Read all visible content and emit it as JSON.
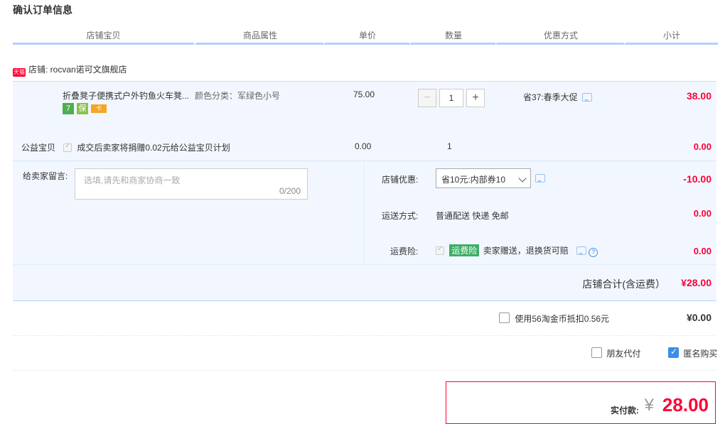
{
  "page_title": "确认订单信息",
  "columns": [
    "店铺宝贝",
    "商品属性",
    "单价",
    "数量",
    "优惠方式",
    "小计"
  ],
  "shop": {
    "badge": "天猫",
    "label": "店铺: rocvan诺可文旗舰店"
  },
  "item": {
    "title": "折叠凳子便携式户外钓鱼火车凳...",
    "sku": "颜色分类：军绿色小号",
    "price": "75.00",
    "quantity": "1",
    "promo": "省37:春季大促",
    "subtotal": "38.00",
    "service_badges": [
      "7",
      "保",
      "卡"
    ]
  },
  "charity": {
    "label": "公益宝贝",
    "desc": "成交后卖家将捐赠0.02元给公益宝贝计划",
    "price": "0.00",
    "quantity": "1",
    "subtotal": "0.00"
  },
  "message": {
    "label": "给卖家留言:",
    "placeholder": "选填,请先和商家协商一致",
    "counter": "0/200"
  },
  "shop_discount": {
    "label": "店铺优惠:",
    "selected": "省10元:内部券10",
    "amount": "-10.00"
  },
  "shipping": {
    "label": "运送方式:",
    "value": "普通配送 快递 免邮",
    "amount": "0.00"
  },
  "insurance": {
    "label": "运费险:",
    "tag": "运费险",
    "desc": "卖家赠送，退换货可赔",
    "amount": "0.00"
  },
  "shop_total": {
    "label": "店铺合计(含运费）",
    "amount": "¥28.00"
  },
  "coins": {
    "label": "使用56淘金币抵扣0.56元",
    "amount": "¥0.00",
    "checked": false
  },
  "options": {
    "friend_pay": "朋友代付",
    "friend_pay_checked": false,
    "anonymous": "匿名购买",
    "anonymous_checked": true
  },
  "pay": {
    "label": "实付款:",
    "currency": "¥",
    "amount": "28.00"
  },
  "colors": {
    "accent_red": "#ff0036",
    "header_line": "#b2d1ff",
    "block_bg": "#f2f7ff",
    "checkbox_blue": "#3a8ee6",
    "tag_green": "#3cae66"
  }
}
